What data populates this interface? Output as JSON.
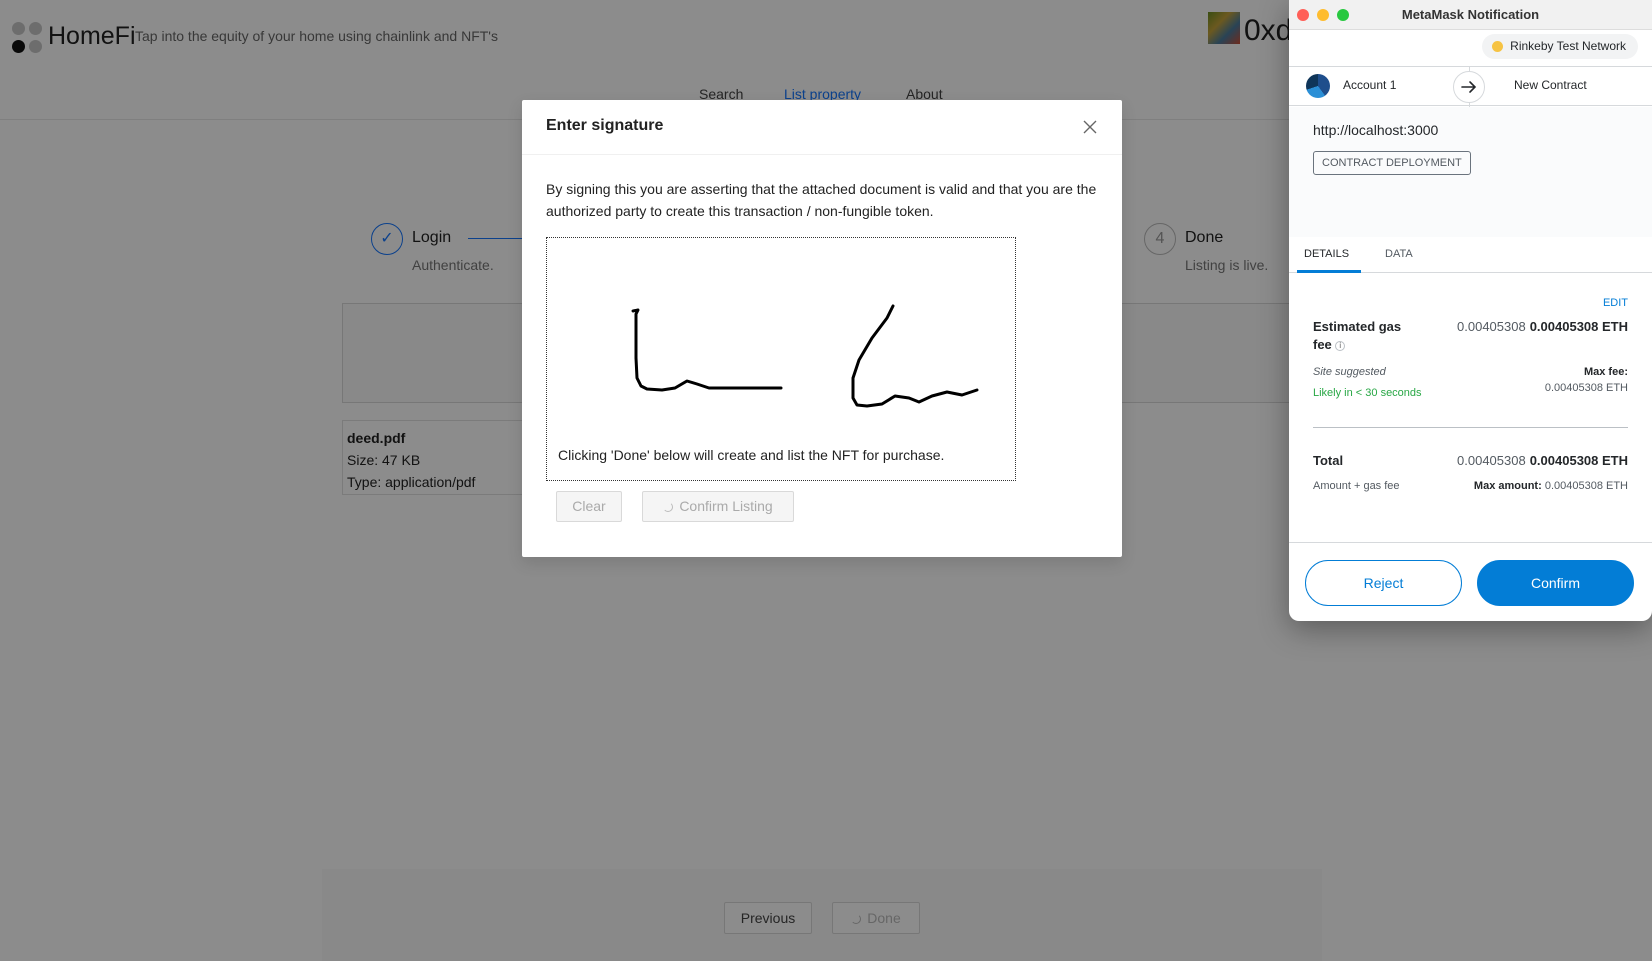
{
  "app": {
    "title": "HomeFi",
    "tagline": "Tap into the equity of your home using chainlink and NFT's",
    "wallet_address": "0xd",
    "nav": [
      "Search",
      "List property",
      "About"
    ]
  },
  "steps": [
    {
      "title": "Login",
      "description": "Authenticate.",
      "status": "finished"
    },
    {
      "number": "4",
      "title": "Done",
      "description": "Listing is live.",
      "status": "waiting"
    }
  ],
  "file": {
    "name": "deed.pdf",
    "size": "Size: 47 KB",
    "type": "Type: application/pdf"
  },
  "footer": {
    "previous_label": "Previous",
    "done_label": "Done"
  },
  "modal": {
    "title": "Enter signature",
    "description": "By signing this you are asserting that the attached document is valid and that you are the authorized party to create this transaction / non-fungible token.",
    "caption": "Clicking 'Done' below will create and list the NFT for purchase.",
    "clear_label": "Clear",
    "confirm_label": "Confirm Listing"
  },
  "metamask": {
    "window_title": "MetaMask Notification",
    "network": "Rinkeby Test Network",
    "account": "Account 1",
    "recipient": "New Contract",
    "origin": "http://localhost:3000",
    "badge": "CONTRACT DEPLOYMENT",
    "tabs": [
      "DETAILS",
      "DATA"
    ],
    "edit_label": "EDIT",
    "gas_label_line1": "Estimated gas",
    "gas_label_line2": "fee",
    "gas_value": "0.00405308",
    "gas_value_bold": "0.00405308 ETH",
    "site_suggested": "Site suggested",
    "likely": "Likely in < 30 seconds",
    "max_fee_label": "Max fee:",
    "max_fee_value": "0.00405308 ETH",
    "total_label": "Total",
    "total_value": "0.00405308",
    "total_value_bold": "0.00405308 ETH",
    "amount_gas": "Amount + gas fee",
    "max_amount_label": "Max amount:",
    "max_amount_value": "0.00405308 ETH",
    "reject_label": "Reject",
    "confirm_label": "Confirm"
  }
}
